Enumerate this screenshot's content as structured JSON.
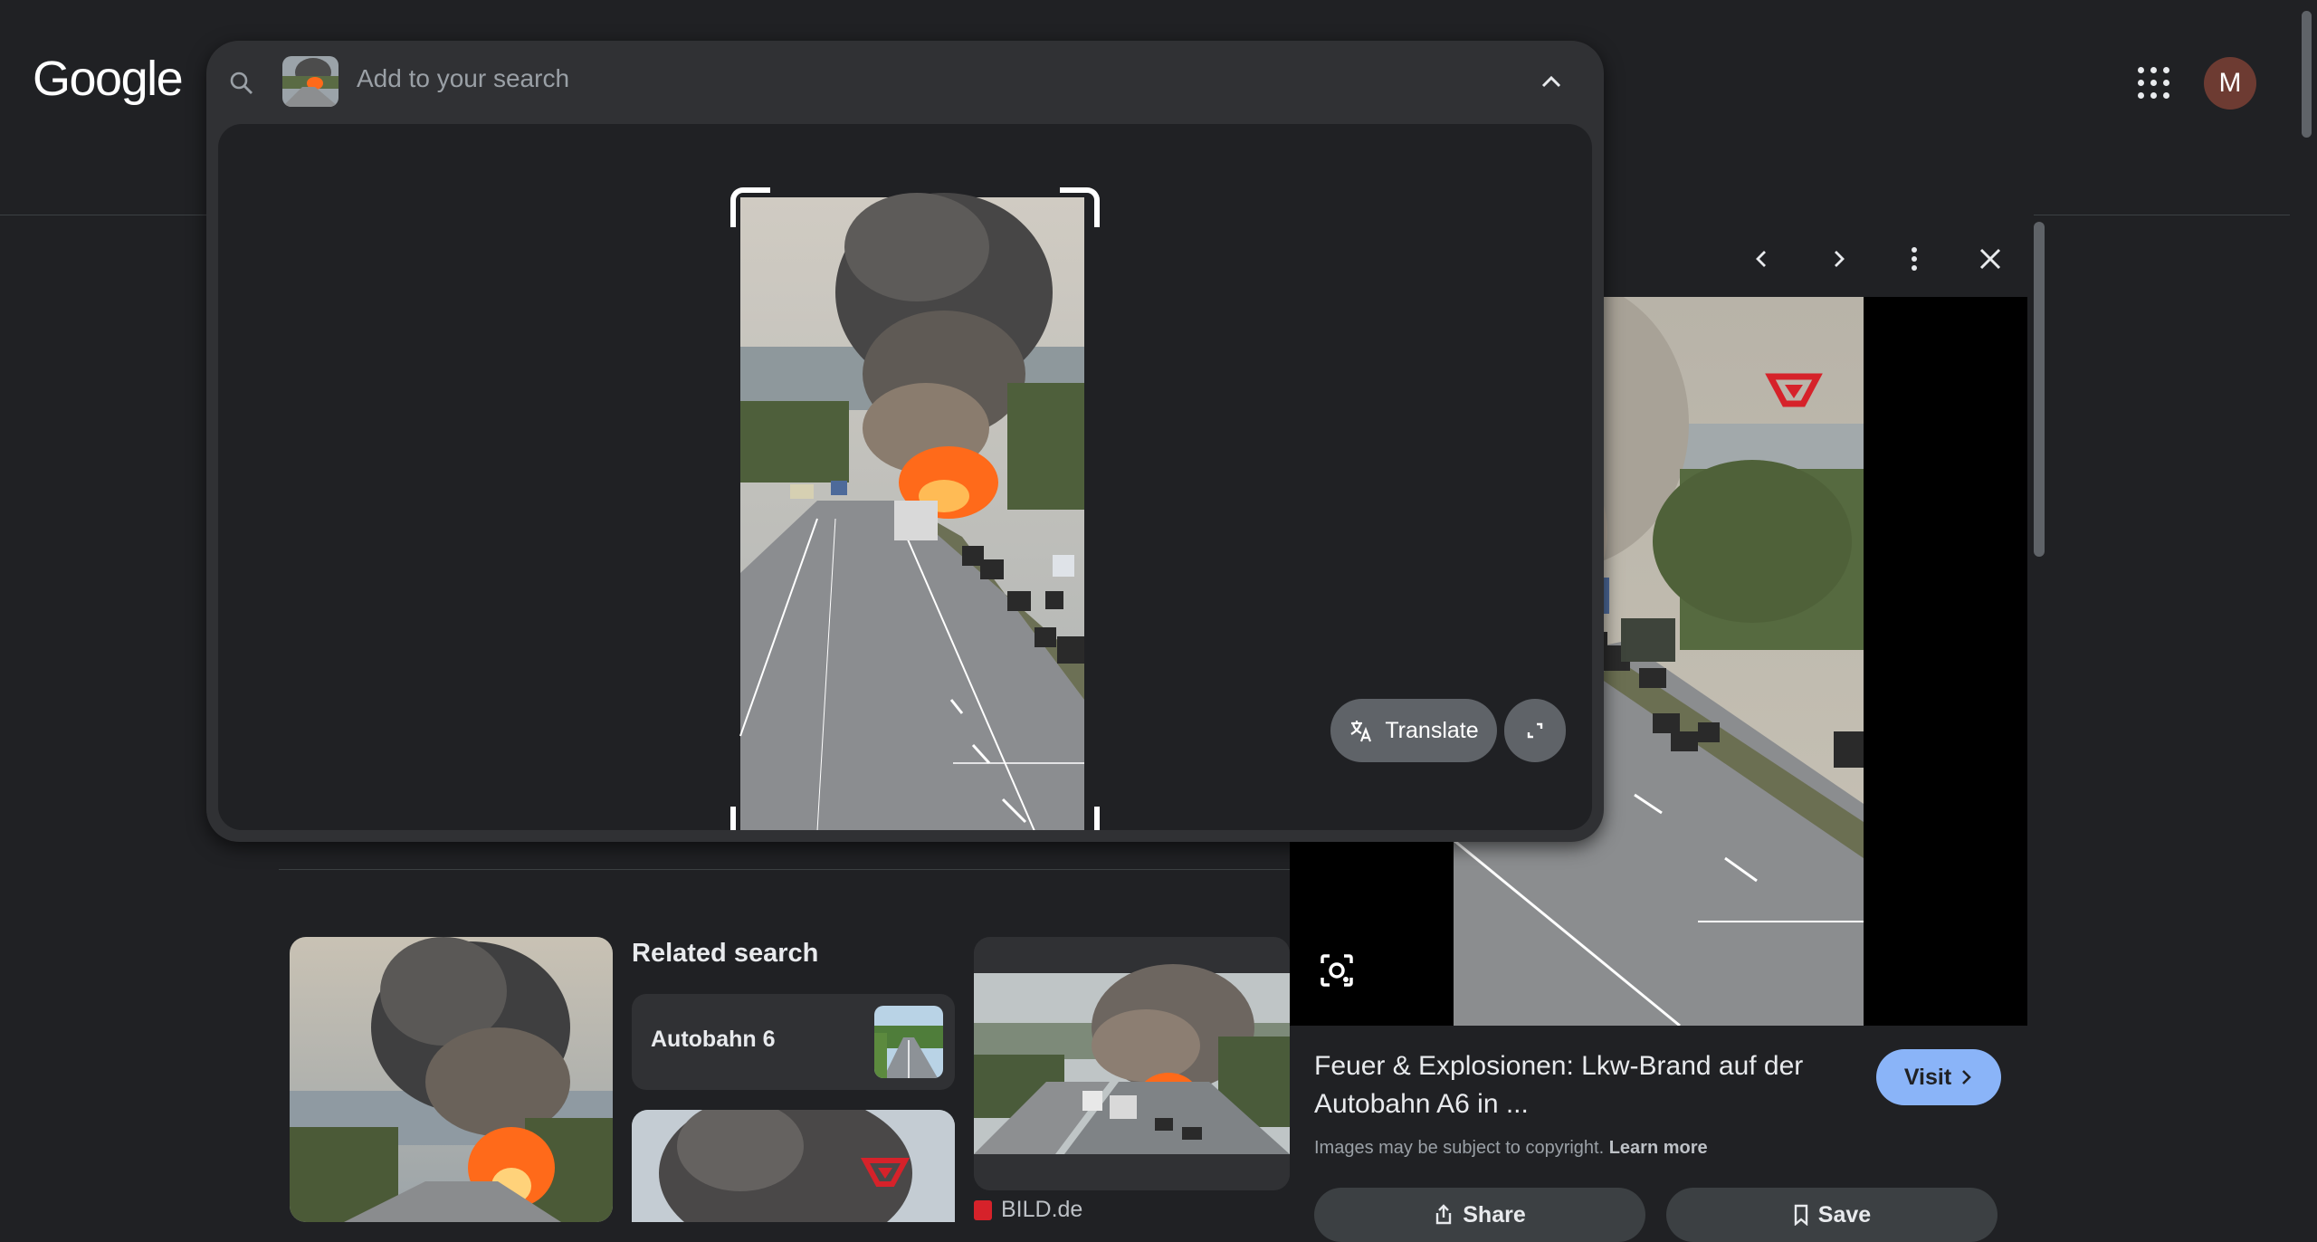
{
  "header": {
    "logo_text": "Google",
    "avatar_initial": "M",
    "apps_icon": "apps-grid-icon"
  },
  "lens": {
    "placeholder": "Add to your search",
    "translate_label": "Translate",
    "icons": [
      "search-icon",
      "chevron-up-icon",
      "translate-icon",
      "expand-icon"
    ]
  },
  "side_panel": {
    "title": "Feuer & Explosionen: Lkw-Brand auf der Autobahn A6 in ...",
    "visit_label": "Visit",
    "copyright_text": "Images may be subject to copyright.",
    "learn_more": "Learn more",
    "share_label": "Share",
    "save_label": "Save",
    "icons": [
      "chevron-left-icon",
      "chevron-right-icon",
      "more-vert-icon",
      "close-icon",
      "lens-search-icon",
      "share-icon",
      "bookmark-icon",
      "chevron-right-small-icon"
    ]
  },
  "results": {
    "related_heading": "Related search",
    "related_item": "Autobahn 6",
    "source_3": "BILD.de"
  },
  "colors": {
    "background": "#202124",
    "surface": "#303134",
    "accent": "#8ab4f8",
    "fire": "#ff6a1a",
    "smoke": "#4a4a4a"
  }
}
